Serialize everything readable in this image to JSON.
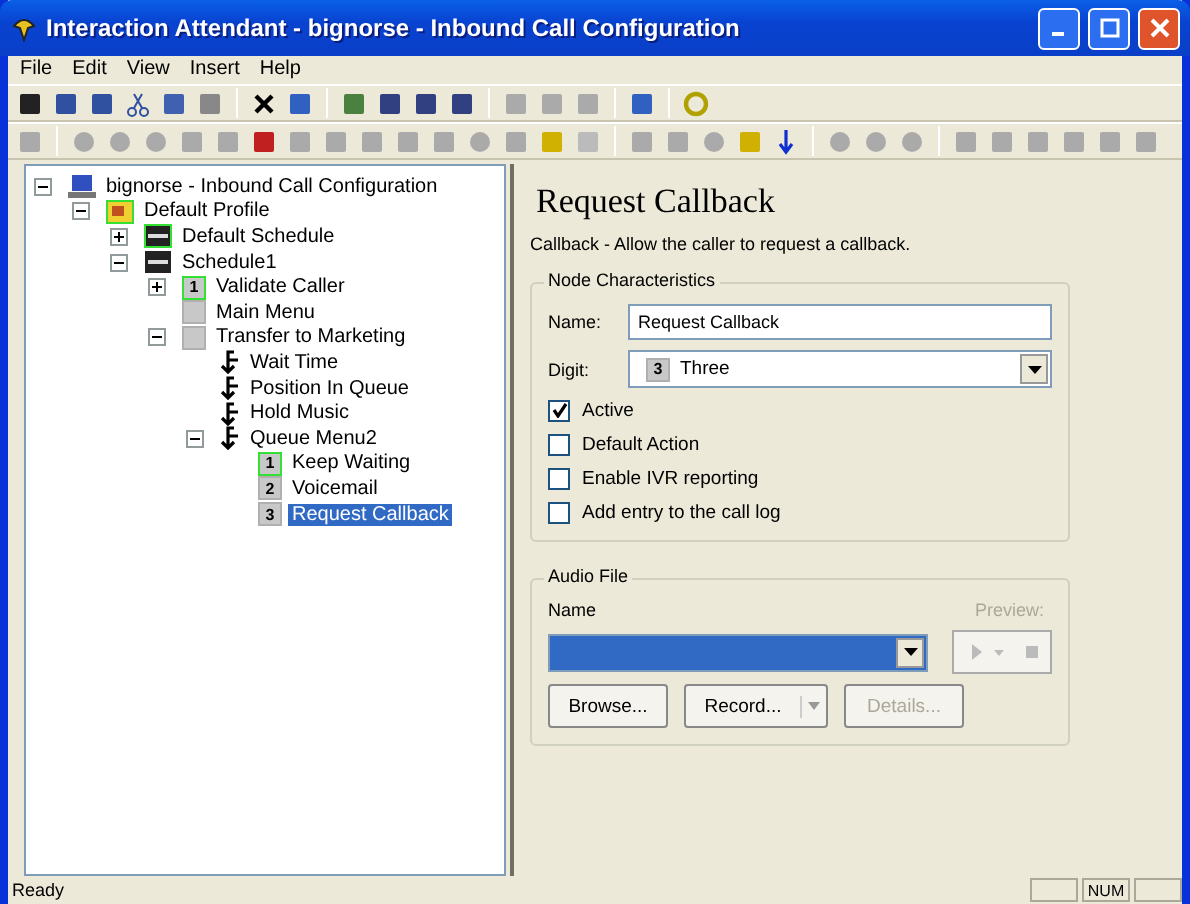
{
  "window": {
    "title": "Interaction Attendant - bignorse - Inbound Call Configuration"
  },
  "menu": [
    "File",
    "Edit",
    "View",
    "Insert",
    "Help"
  ],
  "tree": [
    {
      "label": "bignorse - Inbound Call Configuration",
      "kind": "computer",
      "expanded": true,
      "highlighted": false,
      "selected": false,
      "children": [
        {
          "label": "Default Profile",
          "kind": "profile",
          "expanded": true,
          "highlighted": true,
          "selected": false,
          "children": [
            {
              "label": "Default Schedule",
              "kind": "schedule",
              "expanded": false,
              "highlighted": true,
              "selected": false
            },
            {
              "label": "Schedule1",
              "kind": "schedule",
              "expanded": true,
              "highlighted": false,
              "selected": false,
              "children": [
                {
                  "label": "Validate Caller",
                  "kind": "digit",
                  "digit": "1",
                  "expanded": false,
                  "highlighted": true,
                  "selected": false
                },
                {
                  "label": "Main Menu",
                  "kind": "menu",
                  "highlighted": false,
                  "selected": false
                },
                {
                  "label": "Transfer to Marketing",
                  "kind": "menu",
                  "expanded": true,
                  "highlighted": false,
                  "selected": false,
                  "children": [
                    {
                      "label": "Wait Time",
                      "kind": "queue",
                      "highlighted": false,
                      "selected": false
                    },
                    {
                      "label": "Position In Queue",
                      "kind": "queue",
                      "highlighted": false,
                      "selected": false
                    },
                    {
                      "label": "Hold Music",
                      "kind": "queue",
                      "highlighted": false,
                      "selected": false
                    },
                    {
                      "label": "Queue Menu2",
                      "kind": "queue",
                      "expanded": true,
                      "highlighted": false,
                      "selected": false,
                      "children": [
                        {
                          "label": "Keep Waiting",
                          "kind": "digit",
                          "digit": "1",
                          "highlighted": true,
                          "selected": false
                        },
                        {
                          "label": "Voicemail",
                          "kind": "digit",
                          "digit": "2",
                          "highlighted": false,
                          "selected": false
                        },
                        {
                          "label": "Request Callback",
                          "kind": "digit",
                          "digit": "3",
                          "highlighted": false,
                          "selected": true
                        }
                      ]
                    }
                  ]
                }
              ]
            }
          ]
        }
      ]
    }
  ],
  "detail": {
    "title": "Request Callback",
    "description": "Callback - Allow the caller to request a callback.",
    "node_group": {
      "legend": "Node Characteristics",
      "name_label": "Name:",
      "name_value": "Request Callback",
      "digit_label": "Digit:",
      "digit_badge": "3",
      "digit_value": "Three",
      "checkboxes": [
        {
          "label": "Active",
          "checked": true
        },
        {
          "label": "Default Action",
          "checked": false
        },
        {
          "label": "Enable IVR reporting",
          "checked": false
        },
        {
          "label": "Add entry to the call log",
          "checked": false
        }
      ]
    },
    "audio_group": {
      "legend": "Audio File",
      "name_label": "Name",
      "preview_label": "Preview:",
      "preview_disabled": true,
      "buttons": [
        {
          "label": "Browse...",
          "disabled": false,
          "kind": "plain"
        },
        {
          "label": "Record...",
          "disabled": false,
          "kind": "split"
        },
        {
          "label": "Details...",
          "disabled": true,
          "kind": "plain"
        }
      ]
    }
  },
  "status_bar": {
    "text": "Ready",
    "num": "NUM"
  }
}
